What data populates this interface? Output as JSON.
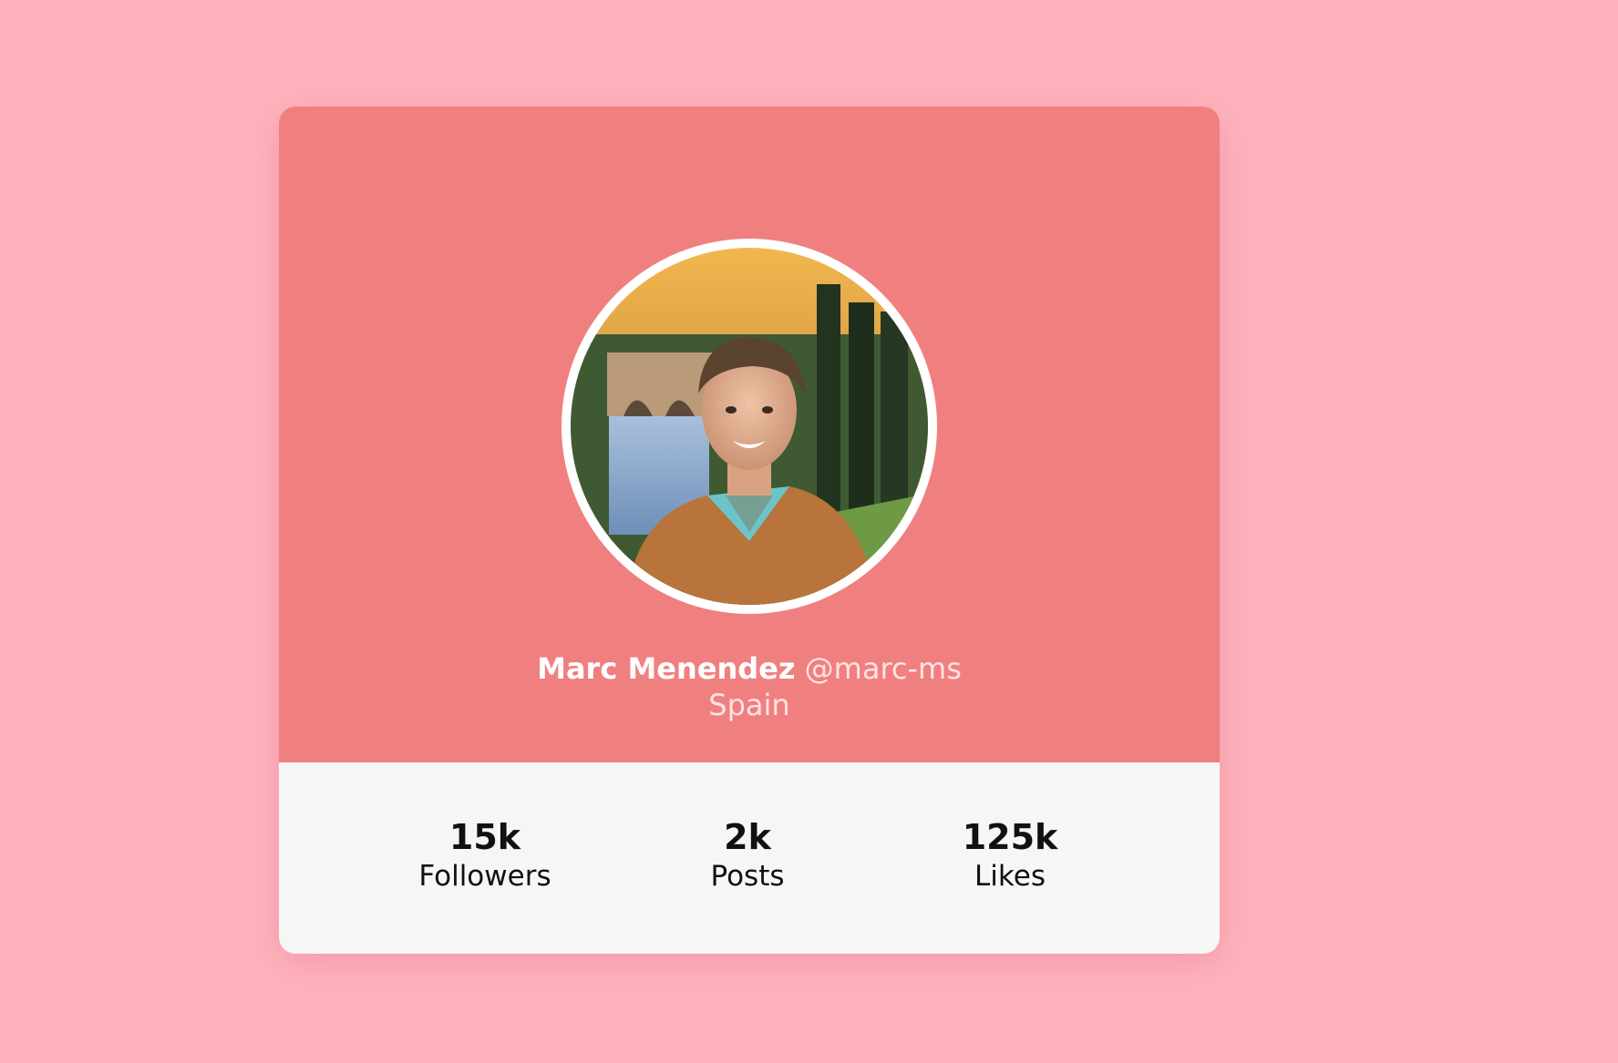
{
  "profile": {
    "name": "Marc Menendez",
    "handle": "@marc-ms",
    "location": "Spain"
  },
  "stats": [
    {
      "value": "15k",
      "label": "Followers"
    },
    {
      "value": "2k",
      "label": "Posts"
    },
    {
      "value": "125k",
      "label": "Likes"
    }
  ],
  "colors": {
    "page_background": "#ffb3bd",
    "card_header": "#f08080",
    "card_footer": "#f6f6f6",
    "primary_text": "#ffffff",
    "secondary_text": "#ffe2e2"
  }
}
